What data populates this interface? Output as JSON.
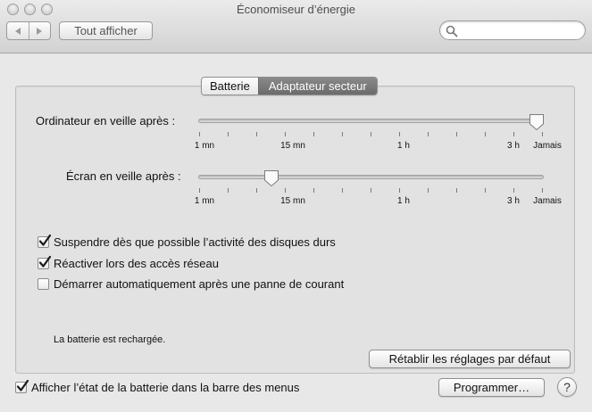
{
  "window": {
    "title": "Économiseur d’énergie"
  },
  "toolbar": {
    "back_icon": "chevron-left-icon",
    "forward_icon": "chevron-right-icon",
    "show_all_label": "Tout afficher",
    "search": {
      "value": "",
      "placeholder": "",
      "icon": "magnifier-icon"
    }
  },
  "tabs": [
    {
      "label": "Batterie",
      "selected": false
    },
    {
      "label": "Adaptateur secteur",
      "selected": true
    }
  ],
  "sliders": {
    "computer": {
      "label": "Ordinateur en veille après :",
      "value": "Jamais",
      "tick_labels": [
        "1 mn",
        "15 mn",
        "1 h",
        "3 h",
        "Jamais"
      ]
    },
    "display": {
      "label": "Écran en veille après :",
      "value": "10 mn",
      "tick_labels": [
        "1 mn",
        "15 mn",
        "1 h",
        "3 h",
        "Jamais"
      ]
    }
  },
  "options": [
    {
      "label": "Suspendre dès que possible l’activité des disques durs",
      "checked": true
    },
    {
      "label": "Réactiver lors des accès réseau",
      "checked": true
    },
    {
      "label": "Démarrer automatiquement après une panne de courant",
      "checked": false
    }
  ],
  "status_text": "La batterie est rechargée.",
  "restore_defaults_label": "Rétablir les réglages par défaut",
  "show_battery_status": {
    "label": "Afficher l’état de la batterie dans la barre des menus",
    "checked": true
  },
  "schedule_label": "Programmer…",
  "help_label": "?",
  "colors": {
    "selected_tab": "#7a7a7a",
    "panel": "#e2e2e2",
    "window": "#e8e8e8"
  }
}
